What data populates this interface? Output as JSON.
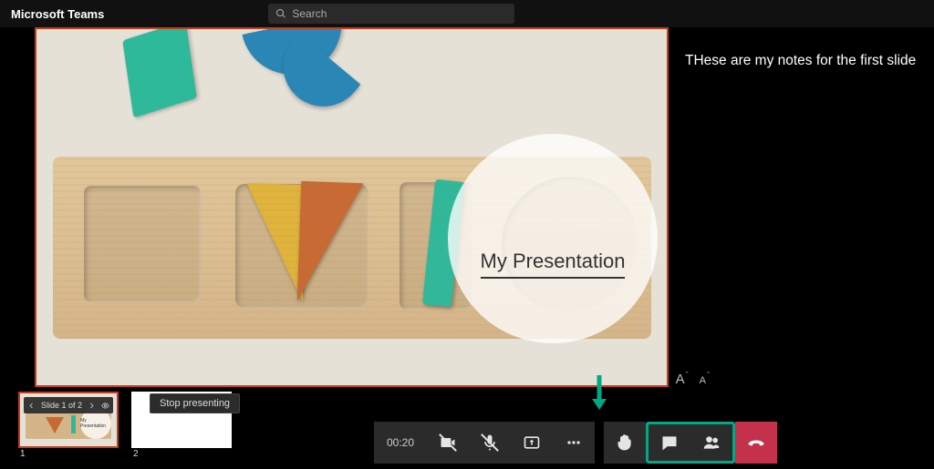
{
  "app": {
    "title": "Microsoft Teams"
  },
  "search": {
    "placeholder": "Search"
  },
  "slide": {
    "title": "My Presentation"
  },
  "notes": {
    "text": "THese are my notes for the first slide"
  },
  "fontControls": {
    "increase": "A",
    "decrease": "A"
  },
  "thumbnails": {
    "overlay_label": "Slide 1 of 2",
    "stop_label": "Stop presenting",
    "items": [
      {
        "number": "1",
        "caption": "My Presentation"
      },
      {
        "number": "2",
        "caption": ""
      }
    ]
  },
  "callbar": {
    "timer": "00:20"
  }
}
